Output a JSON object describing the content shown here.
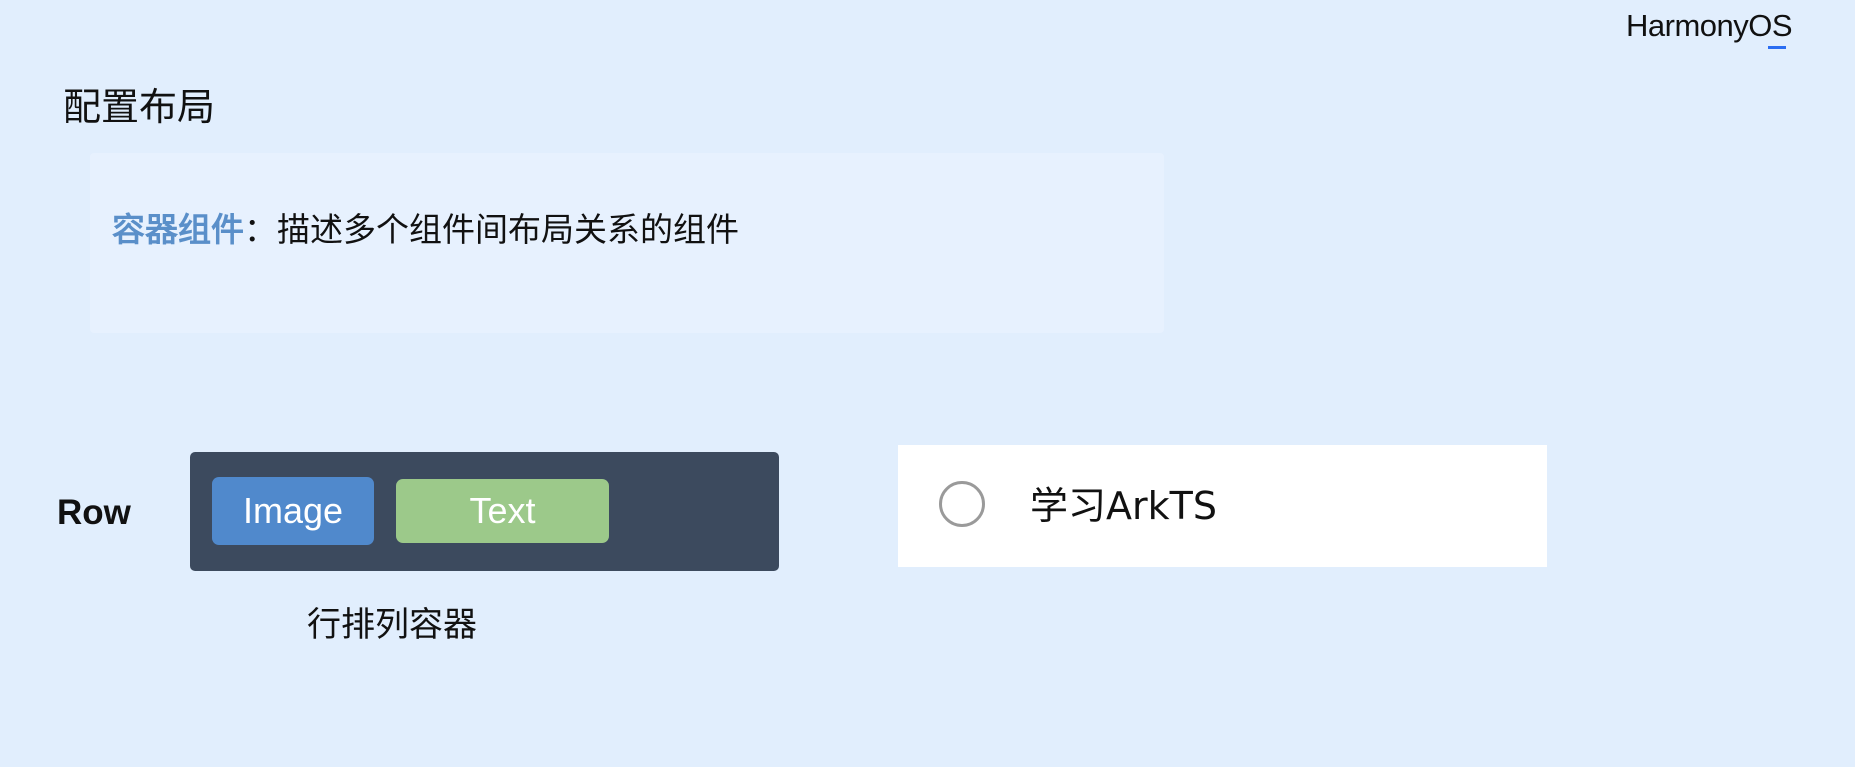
{
  "brand": {
    "logo_text": "HarmonyOS"
  },
  "page": {
    "title": "配置布局"
  },
  "definition": {
    "term": "容器组件",
    "separator": "：",
    "description": "描述多个组件间布局关系的组件"
  },
  "row_demo": {
    "label": "Row",
    "children": [
      "Image",
      "Text"
    ],
    "caption": "行排列容器"
  },
  "todo": {
    "label": "学习ArkTS",
    "checked": false
  },
  "colors": {
    "background": "#e1eefd",
    "term_accent": "#5a8fc9",
    "container_bg": "#3c4a5e",
    "image_chip": "#5089cc",
    "text_chip": "#9cc98a"
  }
}
